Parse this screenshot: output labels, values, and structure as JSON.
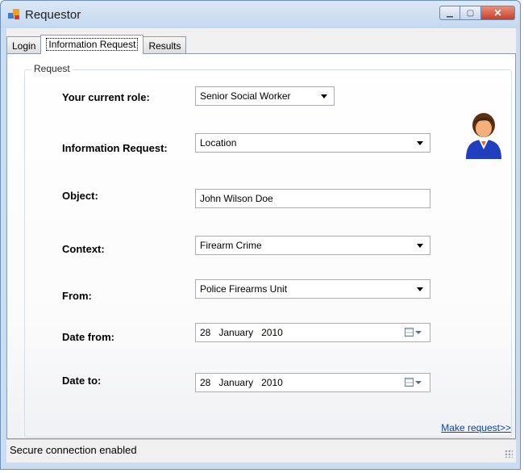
{
  "window": {
    "title": "Requestor"
  },
  "tabs": [
    {
      "label": "Login"
    },
    {
      "label": "Information Request"
    },
    {
      "label": "Results"
    }
  ],
  "request_group": {
    "label": "Request"
  },
  "form": {
    "role": {
      "label": "Your current role:",
      "value": "Senior Social Worker"
    },
    "info_request": {
      "label": "Information Request:",
      "value": "Location"
    },
    "object": {
      "label": "Object:",
      "value": "John Wilson Doe"
    },
    "context": {
      "label": "Context:",
      "value": "Firearm Crime"
    },
    "from": {
      "label": "From:",
      "value": "Police Firearms Unit"
    },
    "date_from": {
      "label": "Date from:",
      "day": "28",
      "month": "January",
      "year": "2010"
    },
    "date_to": {
      "label": "Date to:",
      "day": "28",
      "month": "January",
      "year": "2010"
    }
  },
  "make_request_link": "Make request>>",
  "status": {
    "text": "Secure connection enabled"
  },
  "icons": [
    "app-icon",
    "minimize-icon",
    "maximize-icon",
    "close-icon",
    "user-avatar-icon",
    "dropdown-arrow-icon",
    "calendar-icon",
    "resize-grip-icon"
  ]
}
